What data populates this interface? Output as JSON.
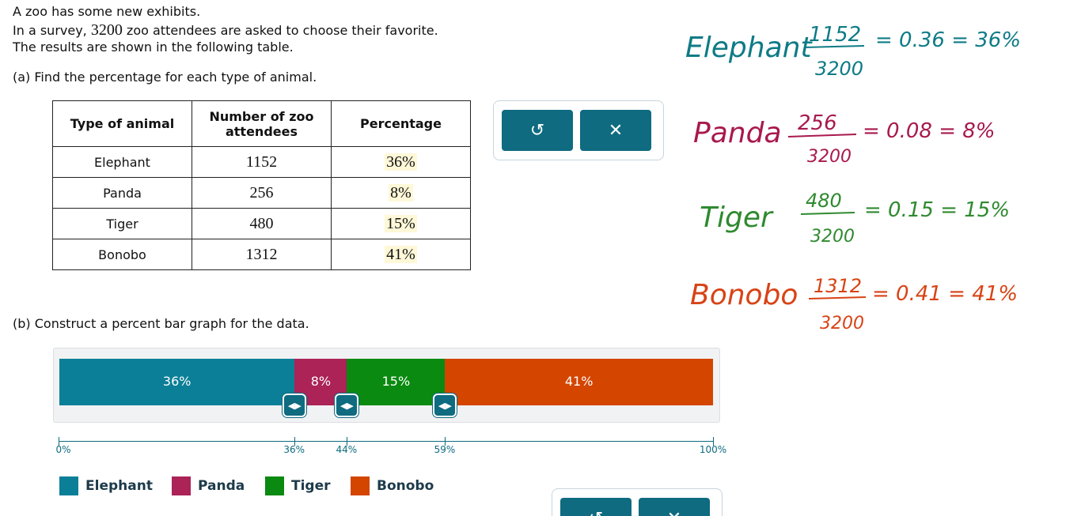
{
  "problem": {
    "line1": "A zoo has some new exhibits.",
    "line2_pre": "In a survey, ",
    "line2_num": "3200",
    "line2_post": " zoo attendees are asked to choose their favorite.",
    "line3": "The results are shown in the following table.",
    "part_a": "(a) Find the percentage for each type of animal.",
    "part_b": "(b) Construct a percent bar graph for the data."
  },
  "table": {
    "headers": [
      "Type of animal",
      "Number of zoo attendees",
      "Percentage"
    ],
    "rows": [
      {
        "animal": "Elephant",
        "count": "1152",
        "pct": "36%"
      },
      {
        "animal": "Panda",
        "count": "256",
        "pct": "8%"
      },
      {
        "animal": "Tiger",
        "count": "480",
        "pct": "15%"
      },
      {
        "animal": "Bonobo",
        "count": "1312",
        "pct": "41%"
      }
    ]
  },
  "toolbar": {
    "undo_icon": "undo-icon",
    "clear_icon": "close-icon",
    "undo_glyph": "↺",
    "clear_glyph": "✕"
  },
  "colors": {
    "teal": "#0e6b80",
    "elephant": "#0b7f97",
    "panda": "#ab2357",
    "tiger": "#0a8a10",
    "bonobo": "#d44500",
    "ink_teal": "#0e7b86",
    "ink_red": "#a8194d",
    "ink_green": "#2f8a2f"
  },
  "chart_data": {
    "type": "bar",
    "stacked": true,
    "categories": [
      "Elephant",
      "Panda",
      "Tiger",
      "Bonobo"
    ],
    "values": [
      36,
      8,
      15,
      41
    ],
    "segment_labels": [
      "36%",
      "8%",
      "15%",
      "41%"
    ],
    "axis_ticks": [
      "0%",
      "36%",
      "44%",
      "59%",
      "100%"
    ],
    "ylim": [
      0,
      100
    ],
    "legend": [
      "Elephant",
      "Panda",
      "Tiger",
      "Bonobo"
    ],
    "legend_placement": "bottom"
  },
  "handwriting": {
    "elephant": {
      "label": "Elephant",
      "num": "1152",
      "den": "3200",
      "result": "= 0.36 = 36%"
    },
    "panda": {
      "label": "Panda",
      "num": "256",
      "den": "3200",
      "result": "= 0.08 = 8%"
    },
    "tiger": {
      "label": "Tiger",
      "num": "480",
      "den": "3200",
      "result": "= 0.15 = 15%"
    },
    "bonobo": {
      "label": "Bonobo",
      "num": "1312",
      "den": "3200",
      "result": "= 0.41 = 41%"
    }
  }
}
